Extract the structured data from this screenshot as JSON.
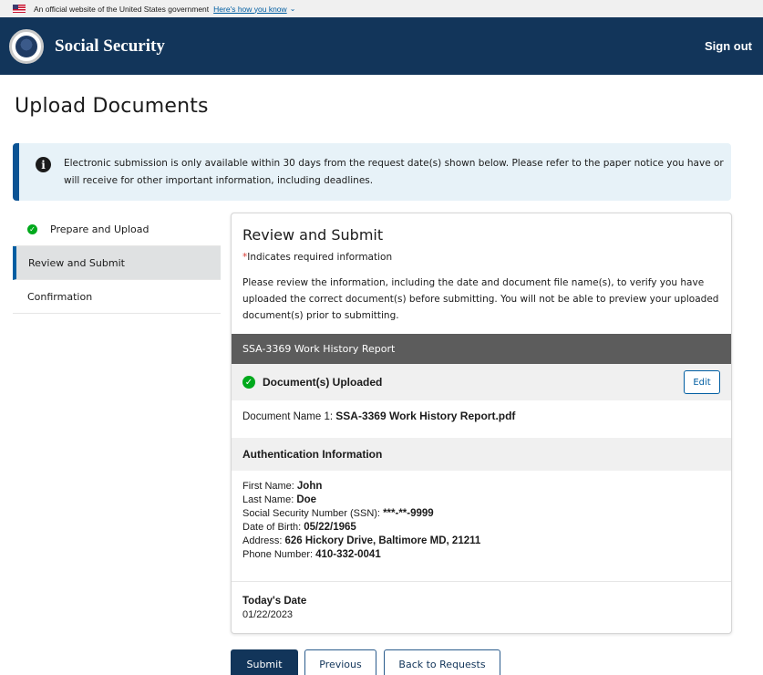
{
  "gov_banner": {
    "text": "An official website of the United States government",
    "link": "Here's how you know",
    "chevron_icon": "chevron-down-icon"
  },
  "header": {
    "brand": "Social Security",
    "sign_out": "Sign out",
    "colors": {
      "background": "#12355a"
    }
  },
  "page_title": "Upload Documents",
  "alert": {
    "icon": "info-icon",
    "text": "Electronic submission is only available within 30 days from the request date(s) shown below. Please refer to the paper notice you have or will receive for other important information, including deadlines."
  },
  "sidenav": {
    "items": [
      {
        "label": "Prepare and Upload",
        "state": "complete"
      },
      {
        "label": "Review and Submit",
        "state": "active"
      },
      {
        "label": "Confirmation",
        "state": "upcoming"
      }
    ]
  },
  "review": {
    "title": "Review and Submit",
    "required_star": "*",
    "required_note": "Indicates required information",
    "instructions": "Please review the information, including the date and document file name(s), to verify you have uploaded the correct document(s) before submitting. You will not be able to preview your uploaded document(s) prior to submitting.",
    "document_section": "SSA-3369 Work History Report",
    "uploaded_label": "Document(s) Uploaded",
    "edit_label": "Edit",
    "doc_name_label": "Document Name 1:",
    "doc_name_value": "SSA-3369 Work History Report.pdf",
    "auth_header": "Authentication Information",
    "auth": {
      "first_name_label": "First Name:",
      "first_name": "John",
      "last_name_label": "Last Name:",
      "last_name": "Doe",
      "ssn_label": "Social Security Number (SSN):",
      "ssn": "***-**-9999",
      "dob_label": "Date of Birth:",
      "dob": "05/22/1965",
      "address_label": "Address:",
      "address": "626 Hickory Drive, Baltimore MD, 21211",
      "phone_label": "Phone Number:",
      "phone": "410-332-0041"
    },
    "todays_date_label": "Today's Date",
    "todays_date": "01/22/2023"
  },
  "buttons": {
    "submit": "Submit",
    "previous": "Previous",
    "back": "Back to Requests"
  }
}
